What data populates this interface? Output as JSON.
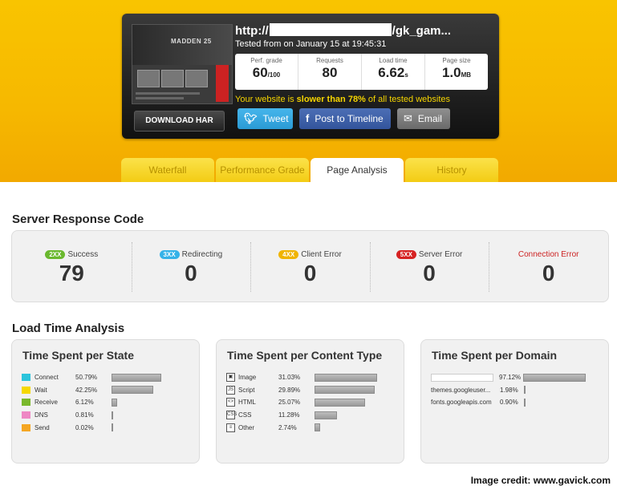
{
  "header": {
    "url_prefix": "http://",
    "url_suffix": "/gk_gam...",
    "tested": "Tested from on January 15 at 19:45:31",
    "thumbnail_title": "MADDEN 25",
    "download_har": "DOWNLOAD HAR",
    "metrics": [
      {
        "label": "Perf. grade",
        "value": "60",
        "unit": "/100"
      },
      {
        "label": "Requests",
        "value": "80",
        "unit": ""
      },
      {
        "label": "Load time",
        "value": "6.62",
        "unit": "s"
      },
      {
        "label": "Page size",
        "value": "1.0",
        "unit": "MB"
      }
    ],
    "slower_pre": "Your website is ",
    "slower_bold": "slower than 78%",
    "slower_post": " of all tested websites",
    "share": {
      "tweet": "Tweet",
      "facebook": "Post to Timeline",
      "email": "Email"
    },
    "share_icons": {
      "tweet": "twitter-icon",
      "facebook": "facebook-icon",
      "email": "email-icon"
    }
  },
  "tabs": [
    "Waterfall",
    "Performance Grade",
    "Page Analysis",
    "History"
  ],
  "active_tab": "Page Analysis",
  "server_response": {
    "title": "Server Response Code",
    "codes": [
      {
        "badge": "2XX",
        "label": "Success",
        "value": "79",
        "color": "#6ab82e"
      },
      {
        "badge": "3XX",
        "label": "Redirecting",
        "value": "0",
        "color": "#35b2e8"
      },
      {
        "badge": "4XX",
        "label": "Client Error",
        "value": "0",
        "color": "#f0b400"
      },
      {
        "badge": "5XX",
        "label": "Server Error",
        "value": "0",
        "color": "#d62222"
      },
      {
        "badge": "",
        "label": "Connection Error",
        "value": "0",
        "color": ""
      }
    ]
  },
  "load_time": {
    "title": "Load Time Analysis",
    "per_state": {
      "title": "Time Spent per State",
      "rows": [
        {
          "name": "Connect",
          "pct": "50.79%",
          "value": 50.79,
          "color": "#2cc4dc"
        },
        {
          "name": "Wait",
          "pct": "42.25%",
          "value": 42.25,
          "color": "#f5d800"
        },
        {
          "name": "Receive",
          "pct": "6.12%",
          "value": 6.12,
          "color": "#7ab82c"
        },
        {
          "name": "DNS",
          "pct": "0.81%",
          "value": 0.81,
          "color": "#ee88c4"
        },
        {
          "name": "Send",
          "pct": "0.02%",
          "value": 0.02,
          "color": "#f5a623"
        }
      ]
    },
    "per_content": {
      "title": "Time Spent per Content Type",
      "rows": [
        {
          "name": "Image",
          "pct": "31.03%",
          "value": 31.03,
          "icon": "image-icon"
        },
        {
          "name": "Script",
          "pct": "29.89%",
          "value": 29.89,
          "icon": "script-icon"
        },
        {
          "name": "HTML",
          "pct": "25.07%",
          "value": 25.07,
          "icon": "html-icon"
        },
        {
          "name": "CSS",
          "pct": "11.28%",
          "value": 11.28,
          "icon": "css-icon"
        },
        {
          "name": "Other",
          "pct": "2.74%",
          "value": 2.74,
          "icon": "other-icon"
        }
      ]
    },
    "per_domain": {
      "title": "Time Spent per Domain",
      "rows": [
        {
          "name": "",
          "pct": "97.12%",
          "value": 97.12
        },
        {
          "name": "themes.googleuser...",
          "pct": "1.98%",
          "value": 1.98
        },
        {
          "name": "fonts.googleapis.com",
          "pct": "0.90%",
          "value": 0.9
        }
      ]
    }
  },
  "credit": "Image credit: www.gavick.com"
}
